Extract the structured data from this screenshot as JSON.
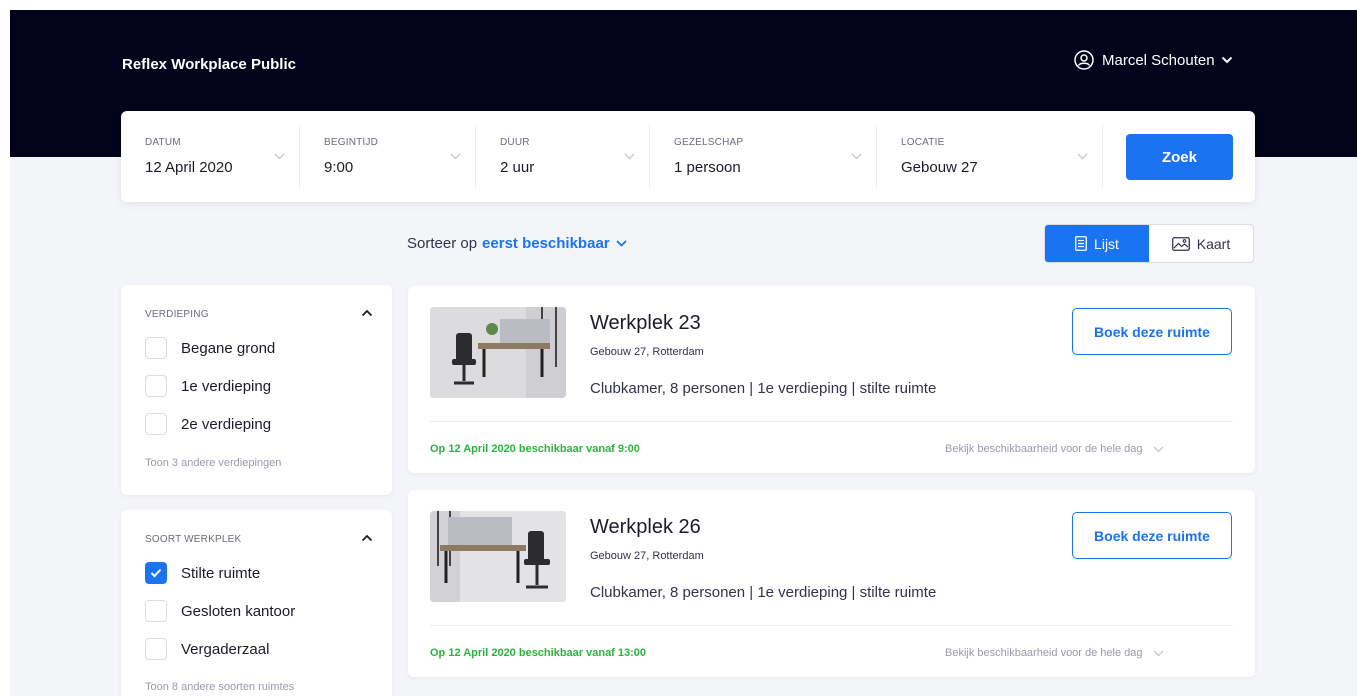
{
  "header": {
    "app_title": "Reflex Workplace Public",
    "user_name": "Marcel Schouten"
  },
  "search": {
    "fields": [
      {
        "label": "DATUM",
        "value": "12 April 2020"
      },
      {
        "label": "BEGINTIJD",
        "value": "9:00"
      },
      {
        "label": "DUUR",
        "value": "2 uur"
      },
      {
        "label": "GEZELSCHAP",
        "value": "1 persoon"
      },
      {
        "label": "LOCATIE",
        "value": "Gebouw 27"
      }
    ],
    "button_label": "Zoek"
  },
  "sort": {
    "prefix": "Sorteer op",
    "value": "eerst beschikbaar"
  },
  "view": {
    "list_label": "Lijst",
    "map_label": "Kaart",
    "active": "list"
  },
  "filters": [
    {
      "title": "VERDIEPING",
      "options": [
        {
          "label": "Begane grond",
          "checked": false
        },
        {
          "label": "1e verdieping",
          "checked": false
        },
        {
          "label": "2e verdieping",
          "checked": false
        }
      ],
      "show_more": "Toon 3 andere verdiepingen"
    },
    {
      "title": "SOORT WERKPLEK",
      "options": [
        {
          "label": "Stilte ruimte",
          "checked": true
        },
        {
          "label": "Gesloten kantoor",
          "checked": false
        },
        {
          "label": "Vergaderzaal",
          "checked": false
        }
      ],
      "show_more": "Toon 8 andere soorten ruimtes"
    }
  ],
  "results": [
    {
      "title": "Werkplek 23",
      "location": "Gebouw 27, Rotterdam",
      "info": "Clubkamer, 8 personen  |  1e verdieping  |  stilte ruimte",
      "book_label": "Boek deze ruimte",
      "availability": "Op 12 April 2020 beschikbaar vanaf 9:00",
      "day_link": "Bekijk beschikbaarheid voor de hele dag"
    },
    {
      "title": "Werkplek 26",
      "location": "Gebouw 27, Rotterdam",
      "info": "Clubkamer, 8 personen  |  1e verdieping  |  stilte ruimte",
      "book_label": "Boek deze ruimte",
      "availability": "Op 12 April 2020 beschikbaar vanaf 13:00",
      "day_link": "Bekijk beschikbaarheid voor de hele dag"
    }
  ],
  "colors": {
    "header_bg": "#03031c",
    "accent": "#1a73f0",
    "available": "#2ab43c"
  }
}
